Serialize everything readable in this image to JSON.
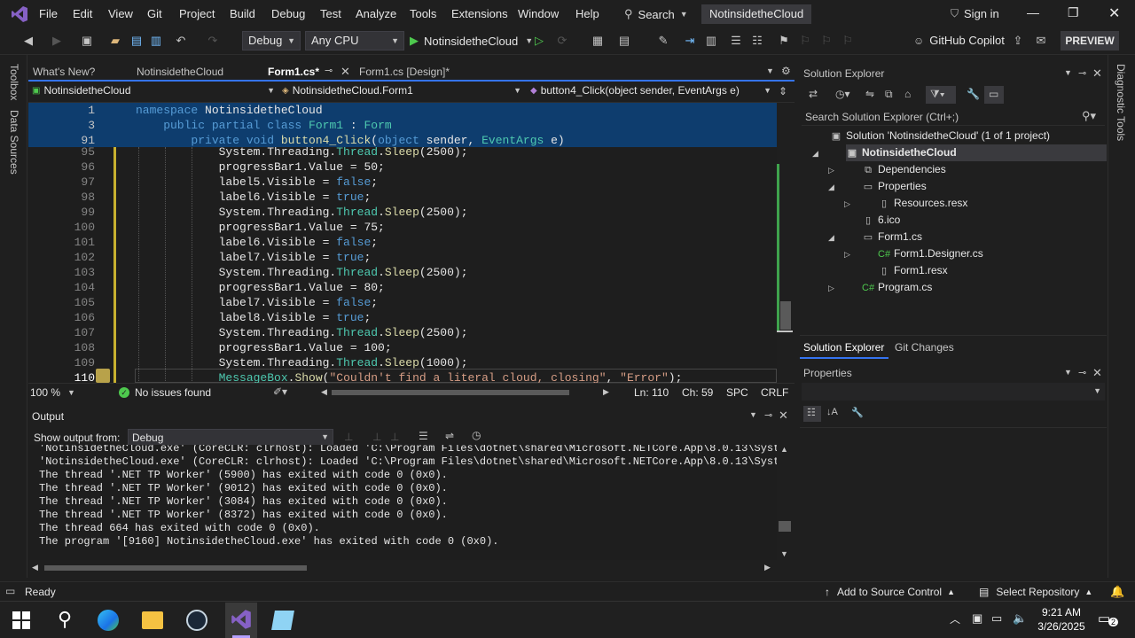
{
  "menu": {
    "items": [
      "File",
      "Edit",
      "View",
      "Git",
      "Project",
      "Build",
      "Debug",
      "Test",
      "Analyze",
      "Tools",
      "Extensions",
      "Window",
      "Help"
    ],
    "search_label": "Search",
    "solution_badge": "NotinsidetheCloud",
    "sign_in": "Sign in"
  },
  "toolbar": {
    "config": "Debug",
    "platform": "Any CPU",
    "run_target": "NotinsidetheCloud",
    "copilot": "GitHub Copilot",
    "preview": "PREVIEW"
  },
  "side": {
    "left_tabs": [
      "Toolbox",
      "Data Sources"
    ],
    "right_tabs": [
      "Diagnostic Tools"
    ]
  },
  "tabs": {
    "items": [
      "What's New?",
      "NotinsidetheCloud",
      "Form1.cs*",
      "Form1.cs [Design]*"
    ]
  },
  "nav": {
    "project": "NotinsidetheCloud",
    "class": "NotinsidetheCloud.Form1",
    "member": "button4_Click(object sender, EventArgs e)"
  },
  "sticky": [
    {
      "ln": "1",
      "tokens": [
        [
          "kw",
          "namespace "
        ],
        [
          "id",
          "NotinsidetheCloud"
        ]
      ]
    },
    {
      "ln": "3",
      "tokens": [
        [
          "kw",
          "    public partial class "
        ],
        [
          "ty",
          "Form1"
        ],
        [
          "id",
          " : "
        ],
        [
          "ty",
          "Form"
        ]
      ]
    },
    {
      "ln": "91",
      "tokens": [
        [
          "kw",
          "        private void "
        ],
        [
          "fn",
          "button4_Click"
        ],
        [
          "id",
          "("
        ],
        [
          "kw",
          "object"
        ],
        [
          "id",
          " sender, "
        ],
        [
          "ty",
          "EventArgs"
        ],
        [
          "id",
          " e)"
        ]
      ]
    }
  ],
  "code": [
    {
      "ln": "95",
      "tokens": [
        [
          "id",
          "            System.Threading."
        ],
        [
          "ty",
          "Thread"
        ],
        [
          "id",
          "."
        ],
        [
          "fn",
          "Sleep"
        ],
        [
          "id",
          "(2500);"
        ]
      ]
    },
    {
      "ln": "96",
      "tokens": [
        [
          "id",
          "            progressBar1.Value = 50;"
        ]
      ]
    },
    {
      "ln": "97",
      "tokens": [
        [
          "id",
          "            label5.Visible = "
        ],
        [
          "kw",
          "false"
        ],
        [
          "id",
          ";"
        ]
      ]
    },
    {
      "ln": "98",
      "tokens": [
        [
          "id",
          "            label6.Visible = "
        ],
        [
          "kw",
          "true"
        ],
        [
          "id",
          ";"
        ]
      ]
    },
    {
      "ln": "99",
      "tokens": [
        [
          "id",
          "            System.Threading."
        ],
        [
          "ty",
          "Thread"
        ],
        [
          "id",
          "."
        ],
        [
          "fn",
          "Sleep"
        ],
        [
          "id",
          "(2500);"
        ]
      ]
    },
    {
      "ln": "100",
      "tokens": [
        [
          "id",
          "            progressBar1.Value = 75;"
        ]
      ]
    },
    {
      "ln": "101",
      "tokens": [
        [
          "id",
          "            label6.Visible = "
        ],
        [
          "kw",
          "false"
        ],
        [
          "id",
          ";"
        ]
      ]
    },
    {
      "ln": "102",
      "tokens": [
        [
          "id",
          "            label7.Visible = "
        ],
        [
          "kw",
          "true"
        ],
        [
          "id",
          ";"
        ]
      ]
    },
    {
      "ln": "103",
      "tokens": [
        [
          "id",
          "            System.Threading."
        ],
        [
          "ty",
          "Thread"
        ],
        [
          "id",
          "."
        ],
        [
          "fn",
          "Sleep"
        ],
        [
          "id",
          "(2500);"
        ]
      ]
    },
    {
      "ln": "104",
      "tokens": [
        [
          "id",
          "            progressBar1.Value = 80;"
        ]
      ]
    },
    {
      "ln": "105",
      "tokens": [
        [
          "id",
          "            label7.Visible = "
        ],
        [
          "kw",
          "false"
        ],
        [
          "id",
          ";"
        ]
      ]
    },
    {
      "ln": "106",
      "tokens": [
        [
          "id",
          "            label8.Visible = "
        ],
        [
          "kw",
          "true"
        ],
        [
          "id",
          ";"
        ]
      ]
    },
    {
      "ln": "107",
      "tokens": [
        [
          "id",
          "            System.Threading."
        ],
        [
          "ty",
          "Thread"
        ],
        [
          "id",
          "."
        ],
        [
          "fn",
          "Sleep"
        ],
        [
          "id",
          "(2500);"
        ]
      ]
    },
    {
      "ln": "108",
      "tokens": [
        [
          "id",
          "            progressBar1.Value = 100;"
        ]
      ]
    },
    {
      "ln": "109",
      "tokens": [
        [
          "id",
          "            System.Threading."
        ],
        [
          "ty",
          "Thread"
        ],
        [
          "id",
          "."
        ],
        [
          "fn",
          "Sleep"
        ],
        [
          "id",
          "(1000);"
        ]
      ]
    },
    {
      "ln": "110",
      "tokens": [
        [
          "ty",
          "            MessageBox"
        ],
        [
          "id",
          "."
        ],
        [
          "fn",
          "Show"
        ],
        [
          "id",
          "("
        ],
        [
          "str",
          "\"Couldn't find a literal cloud, closing\""
        ],
        [
          "id",
          ", "
        ],
        [
          "str",
          "\"Error\""
        ],
        [
          "id",
          ");"
        ]
      ]
    }
  ],
  "editor_status": {
    "zoom": "100 %",
    "issues": "No issues found",
    "line": "Ln: 110",
    "col": "Ch: 59",
    "spc": "SPC",
    "crlf": "CRLF"
  },
  "output": {
    "title": "Output",
    "show_from_label": "Show output from:",
    "source": "Debug",
    "lines": [
      "'NotinsidetheCloud.exe' (CoreCLR: clrhost): Loaded 'C:\\Program Files\\dotnet\\shared\\Microsoft.NETCore.App\\8.0.13\\System.",
      "'NotinsidetheCloud.exe' (CoreCLR: clrhost): Loaded 'C:\\Program Files\\dotnet\\shared\\Microsoft.NETCore.App\\8.0.13\\System.",
      "The thread '.NET TP Worker' (5900) has exited with code 0 (0x0).",
      "The thread '.NET TP Worker' (9012) has exited with code 0 (0x0).",
      "The thread '.NET TP Worker' (3084) has exited with code 0 (0x0).",
      "The thread '.NET TP Worker' (8372) has exited with code 0 (0x0).",
      "The thread 664 has exited with code 0 (0x0).",
      "The program '[9160] NotinsidetheCloud.exe' has exited with code 0 (0x0)."
    ]
  },
  "solution_explorer": {
    "title": "Solution Explorer",
    "search_placeholder": "Search Solution Explorer (Ctrl+;)",
    "items": [
      {
        "label": "Solution 'NotinsidetheCloud' (1 of 1 project)",
        "icon": "▣",
        "arrow": ""
      },
      {
        "label": "NotinsidetheCloud",
        "icon": "▣",
        "arrow": "◢"
      },
      {
        "label": "Dependencies",
        "icon": "⧉",
        "arrow": "▷"
      },
      {
        "label": "Properties",
        "icon": "▭",
        "arrow": "◢"
      },
      {
        "label": "Resources.resx",
        "icon": "▯",
        "arrow": "▷"
      },
      {
        "label": "6.ico",
        "icon": "▯",
        "arrow": ""
      },
      {
        "label": "Form1.cs",
        "icon": "▭",
        "arrow": "◢"
      },
      {
        "label": "Form1.Designer.cs",
        "icon": "C#",
        "arrow": "▷"
      },
      {
        "label": "Form1.resx",
        "icon": "▯",
        "arrow": ""
      },
      {
        "label": "Program.cs",
        "icon": "C#",
        "arrow": "▷"
      }
    ],
    "bottom_tabs": [
      "Solution Explorer",
      "Git Changes"
    ]
  },
  "properties": {
    "title": "Properties"
  },
  "statusbar": {
    "ready": "Ready",
    "source_control": "Add to Source Control",
    "repository": "Select Repository"
  },
  "taskbar": {
    "time": "9:21 AM",
    "date": "3/26/2025",
    "notif_count": "2"
  },
  "colors": {
    "accent": "#3573f0",
    "sticky_bg": "#0e3d6e",
    "vs_purple": "#8661c5"
  }
}
